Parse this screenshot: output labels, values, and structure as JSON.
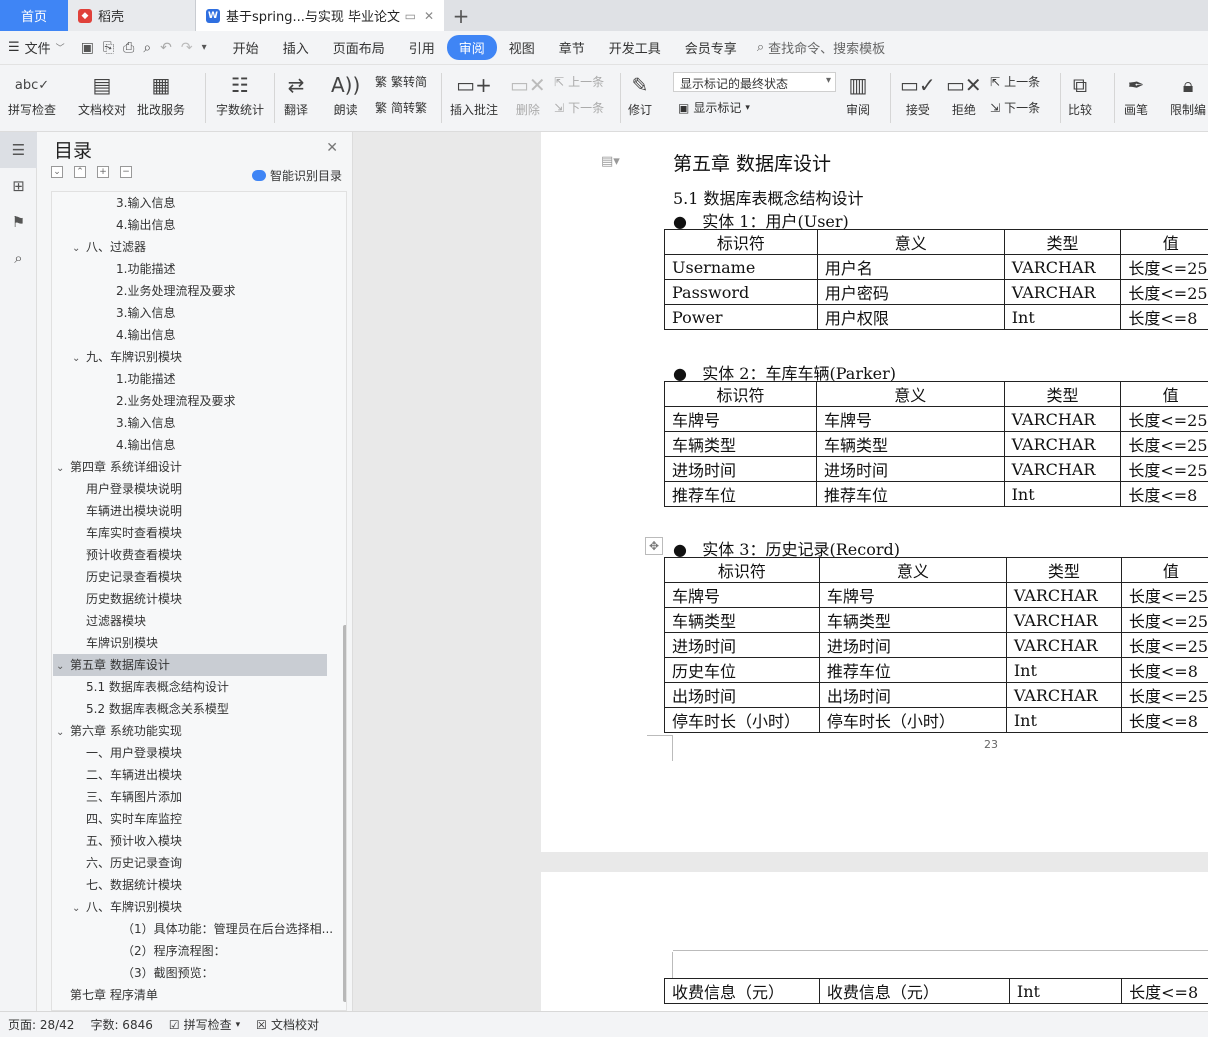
{
  "tabs": {
    "home": "首页",
    "daoke": "稻壳",
    "active_doc": "基于spring...与实现 毕业论文",
    "add": "+"
  },
  "menubar": {
    "file": "文件",
    "items": [
      "开始",
      "插入",
      "页面布局",
      "引用",
      "审阅",
      "视图",
      "章节",
      "开发工具",
      "会员专享"
    ],
    "active_index": 4,
    "search": "查找命令、搜索模板"
  },
  "ribbon": {
    "spell_check": "拼写检查",
    "doc_proof": "文档校对",
    "batch_service": "批改服务",
    "word_count": "字数统计",
    "translate": "翻译",
    "read_aloud": "朗读",
    "to_traditional": "繁转简",
    "to_simplified": "简转繁",
    "insert_comment": "插入批注",
    "delete": "删除",
    "prev": "上一条",
    "next": "下一条",
    "revise": "修订",
    "markup_state": "显示标记的最终状态",
    "show_markup": "显示标记",
    "review": "审阅",
    "accept": "接受",
    "reject": "拒绝",
    "prev2": "上一条",
    "next2": "下一条",
    "compare": "比较",
    "ink": "画笔",
    "restrict": "限制编"
  },
  "toc": {
    "title": "目录",
    "smart": "智能识别目录",
    "items": [
      {
        "text": "3.输入信息",
        "level": 3
      },
      {
        "text": "4.输出信息",
        "level": 3
      },
      {
        "text": "八、过滤器",
        "level": 2,
        "arrow": true
      },
      {
        "text": "1.功能描述",
        "level": 3
      },
      {
        "text": "2.业务处理流程及要求",
        "level": 3
      },
      {
        "text": "3.输入信息",
        "level": 3
      },
      {
        "text": "4.输出信息",
        "level": 3
      },
      {
        "text": "九、车牌识别模块",
        "level": 2,
        "arrow": true
      },
      {
        "text": "1.功能描述",
        "level": 3
      },
      {
        "text": "2.业务处理流程及要求",
        "level": 3
      },
      {
        "text": "3.输入信息",
        "level": 3
      },
      {
        "text": "4.输出信息",
        "level": 3
      },
      {
        "text": "第四章  系统详细设计",
        "level": 1,
        "arrow": true
      },
      {
        "text": "用户登录模块说明",
        "level": 2
      },
      {
        "text": "车辆进出模块说明",
        "level": 2
      },
      {
        "text": "车库实时查看模块",
        "level": 2
      },
      {
        "text": "预计收费查看模块",
        "level": 2
      },
      {
        "text": "历史记录查看模块",
        "level": 2
      },
      {
        "text": "历史数据统计模块",
        "level": 2
      },
      {
        "text": "过滤器模块",
        "level": 2
      },
      {
        "text": "车牌识别模块",
        "level": 2
      },
      {
        "text": "第五章  数据库设计",
        "level": 1,
        "arrow": true
      },
      {
        "text": "5.1 数据库表概念结构设计",
        "level": 2
      },
      {
        "text": "5.2 数据库表概念关系模型",
        "level": 2
      },
      {
        "text": "第六章  系统功能实现",
        "level": 1,
        "arrow": true
      },
      {
        "text": "一、用户登录模块",
        "level": 2
      },
      {
        "text": "二、车辆进出模块",
        "level": 2
      },
      {
        "text": "三、车辆图片添加",
        "level": 2
      },
      {
        "text": "四、实时车库监控",
        "level": 2
      },
      {
        "text": "五、预计收入模块",
        "level": 2
      },
      {
        "text": "六、历史记录查询",
        "level": 2
      },
      {
        "text": "七、数据统计模块",
        "level": 2
      },
      {
        "text": "八、车牌识别模块",
        "level": 2,
        "arrow": true
      },
      {
        "text": "（1）具体功能：管理员在后台选择相...",
        "level": 4
      },
      {
        "text": "（2）程序流程图：",
        "level": 4
      },
      {
        "text": "（3）截图预览：",
        "level": 4
      },
      {
        "text": "第七章  程序清单",
        "level": 1
      }
    ]
  },
  "document": {
    "chapter": "第五章  数据库设计",
    "section": "5.1 数据库表概念结构设计",
    "headers": [
      "标识符",
      "意义",
      "类型",
      "值"
    ],
    "entities": [
      {
        "title": "实体 1：用户(User)",
        "rows": [
          [
            "Username",
            "用户名",
            "VARCHAR",
            "长度<=25"
          ],
          [
            "Password",
            "用户密码",
            "VARCHAR",
            "长度<=25"
          ],
          [
            "Power",
            "用户权限",
            "Int",
            "长度<=8"
          ]
        ]
      },
      {
        "title": "实体 2：车库车辆(Parker)",
        "rows": [
          [
            "车牌号",
            "车牌号",
            "VARCHAR",
            "长度<=25"
          ],
          [
            "车辆类型",
            "车辆类型",
            "VARCHAR",
            "长度<=25"
          ],
          [
            "进场时间",
            "进场时间",
            "VARCHAR",
            "长度<=25"
          ],
          [
            "推荐车位",
            "推荐车位",
            "Int",
            "长度<=8"
          ]
        ]
      },
      {
        "title": "实体 3：历史记录(Record)",
        "rows": [
          [
            "车牌号",
            "车牌号",
            "VARCHAR",
            "长度<=25"
          ],
          [
            "车辆类型",
            "车辆类型",
            "VARCHAR",
            "长度<=25"
          ],
          [
            "进场时间",
            "进场时间",
            "VARCHAR",
            "长度<=25"
          ],
          [
            "历史车位",
            "推荐车位",
            "Int",
            "长度<=8"
          ],
          [
            "出场时间",
            "出场时间",
            "VARCHAR",
            "长度<=25"
          ],
          [
            "停车时长（小时）",
            "停车时长（小时）",
            "Int",
            "长度<=8"
          ]
        ]
      }
    ],
    "page_number": "23",
    "next_page_row": [
      "收费信息（元）",
      "收费信息（元）",
      "Int",
      "长度<=8"
    ]
  },
  "status": {
    "page": "页面: 28/42",
    "words": "字数: 6846",
    "spell": "拼写检查",
    "proof": "文档校对"
  },
  "colors": {
    "accent": "#3f85f5",
    "toc_selected": "#c9cdd3"
  }
}
